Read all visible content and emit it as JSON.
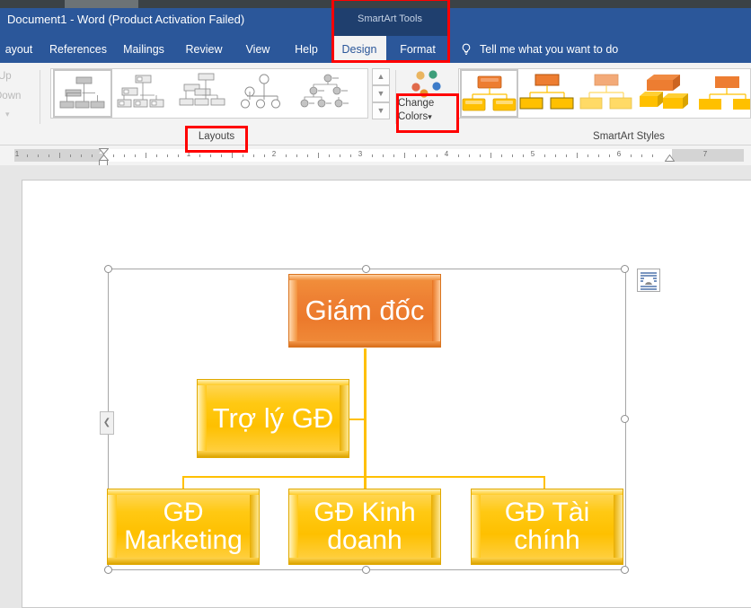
{
  "titlebar": {
    "document_title": "Document1  -  Word (Product Activation Failed)",
    "contextual_tab_group": "SmartArt Tools"
  },
  "ribbon": {
    "tabs": [
      {
        "label": "ayout",
        "active": false
      },
      {
        "label": "References",
        "active": false
      },
      {
        "label": "Mailings",
        "active": false
      },
      {
        "label": "Review",
        "active": false
      },
      {
        "label": "View",
        "active": false
      },
      {
        "label": "Help",
        "active": false
      },
      {
        "label": "Design",
        "active": true
      },
      {
        "label": "Format",
        "active": false
      }
    ],
    "tell_me": "Tell me what you want to do",
    "bulb_icon": "lightbulb-icon",
    "move_up_label": "Up",
    "move_down_label": "Down",
    "layouts_group_label": "Layouts",
    "smartart_styles_group_label": "SmartArt Styles",
    "change_colors_line1": "Change",
    "change_colors_line2": "Colors",
    "change_colors_caret": "▾",
    "scroll_up_icon": "chevron-up-icon",
    "scroll_down_icon": "chevron-down-icon",
    "scroll_more_icon": "chevron-double-down-icon"
  },
  "ruler": {
    "numbers": [
      "1",
      "1",
      "2",
      "3",
      "4",
      "5",
      "6",
      "7"
    ],
    "left_indent_icon": "indent-marker-icon",
    "right_indent_icon": "indent-marker-icon"
  },
  "smartart": {
    "layout_options_icon": "layout-options-icon",
    "text_pane_toggle_icon": "chevron-left-icon",
    "nodes": [
      {
        "id": "director",
        "text": "Giám đốc",
        "level": 0
      },
      {
        "id": "assistant",
        "text": "Trợ lý GĐ",
        "level": 1
      },
      {
        "id": "marketing",
        "text": "GĐ Marketing",
        "level": 2
      },
      {
        "id": "sales",
        "text": "GĐ Kinh doanh",
        "level": 2
      },
      {
        "id": "finance",
        "text": "GĐ Tài chính",
        "level": 2
      }
    ]
  },
  "colors": {
    "titlebar_blue": "#2b579a",
    "contextual_tab_blue": "#1f3f6e",
    "ribbon_bg": "#f3f3f3",
    "node_orange": "#ee8033",
    "node_yellow": "#fec000",
    "connector_yellow": "#ffc000",
    "annotation_red": "#ff0000",
    "page_white": "#ffffff",
    "doc_bg_gray": "#e6e6e6"
  },
  "annotations": [
    {
      "name": "smartart-tools-highlight"
    },
    {
      "name": "layouts-label-highlight"
    },
    {
      "name": "change-colors-highlight"
    }
  ]
}
